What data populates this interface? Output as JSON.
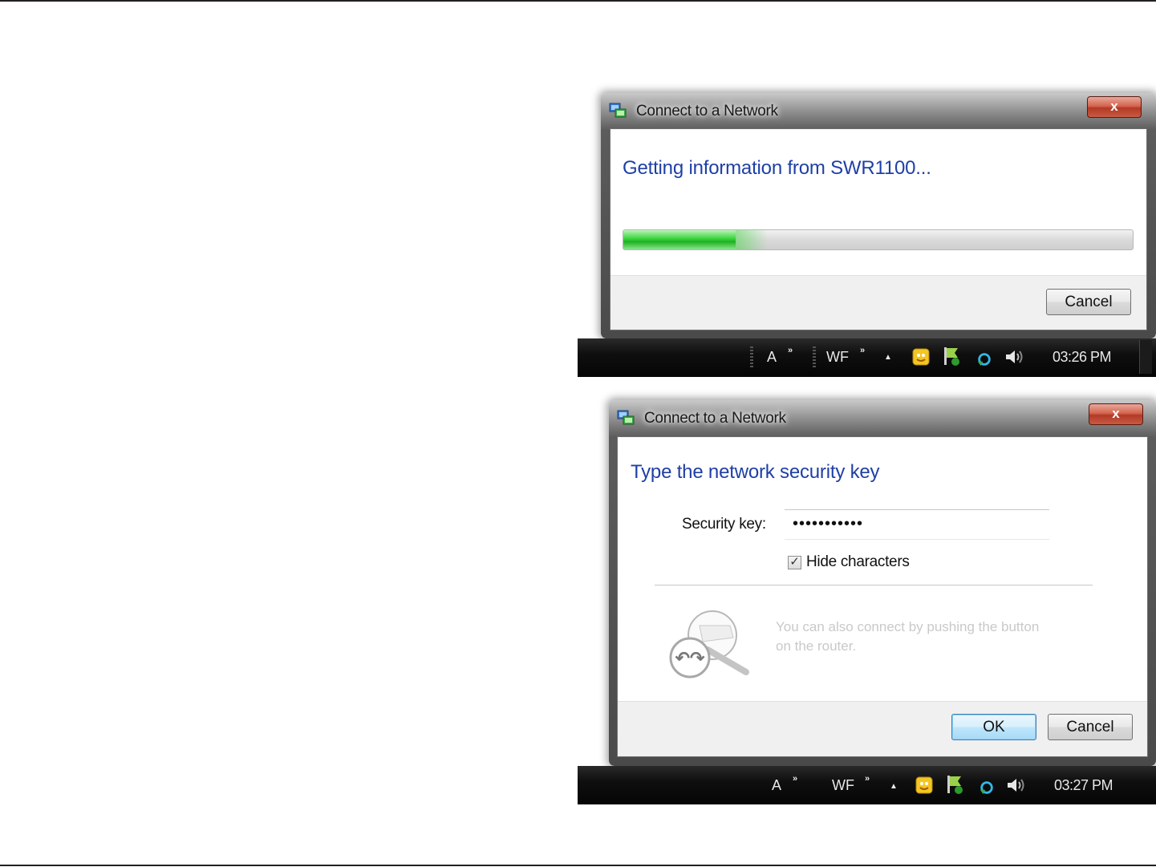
{
  "dialog1": {
    "title": "Connect to a Network",
    "heading": "Getting information from SWR1100...",
    "progress_fraction": 0.22,
    "cancel_label": "Cancel",
    "close_label": "x"
  },
  "taskbar1": {
    "lang": "A",
    "lang_chevron": "»",
    "wf": "WF",
    "wf_chevron": "»",
    "tray_arrow": "▲",
    "clock": "03:26 PM"
  },
  "dialog2": {
    "title": "Connect to a Network",
    "heading": "Type the network security key",
    "security_key_label": "Security key:",
    "security_key_value": "•••••••••••",
    "hide_characters_label": "Hide characters",
    "hide_characters_checked": true,
    "check_mark": "✓",
    "hint": "You can also connect by pushing the button on the router.",
    "ok_label": "OK",
    "cancel_label": "Cancel",
    "close_label": "x"
  },
  "taskbar2": {
    "lang": "A",
    "lang_chevron": "»",
    "wf": "WF",
    "wf_chevron": "»",
    "tray_arrow": "▲",
    "clock": "03:27 PM"
  },
  "icons": [
    "network-icon",
    "close-icon",
    "wps-router-icon",
    "messenger-icon",
    "flag-icon",
    "sync-icon",
    "speaker-icon"
  ]
}
